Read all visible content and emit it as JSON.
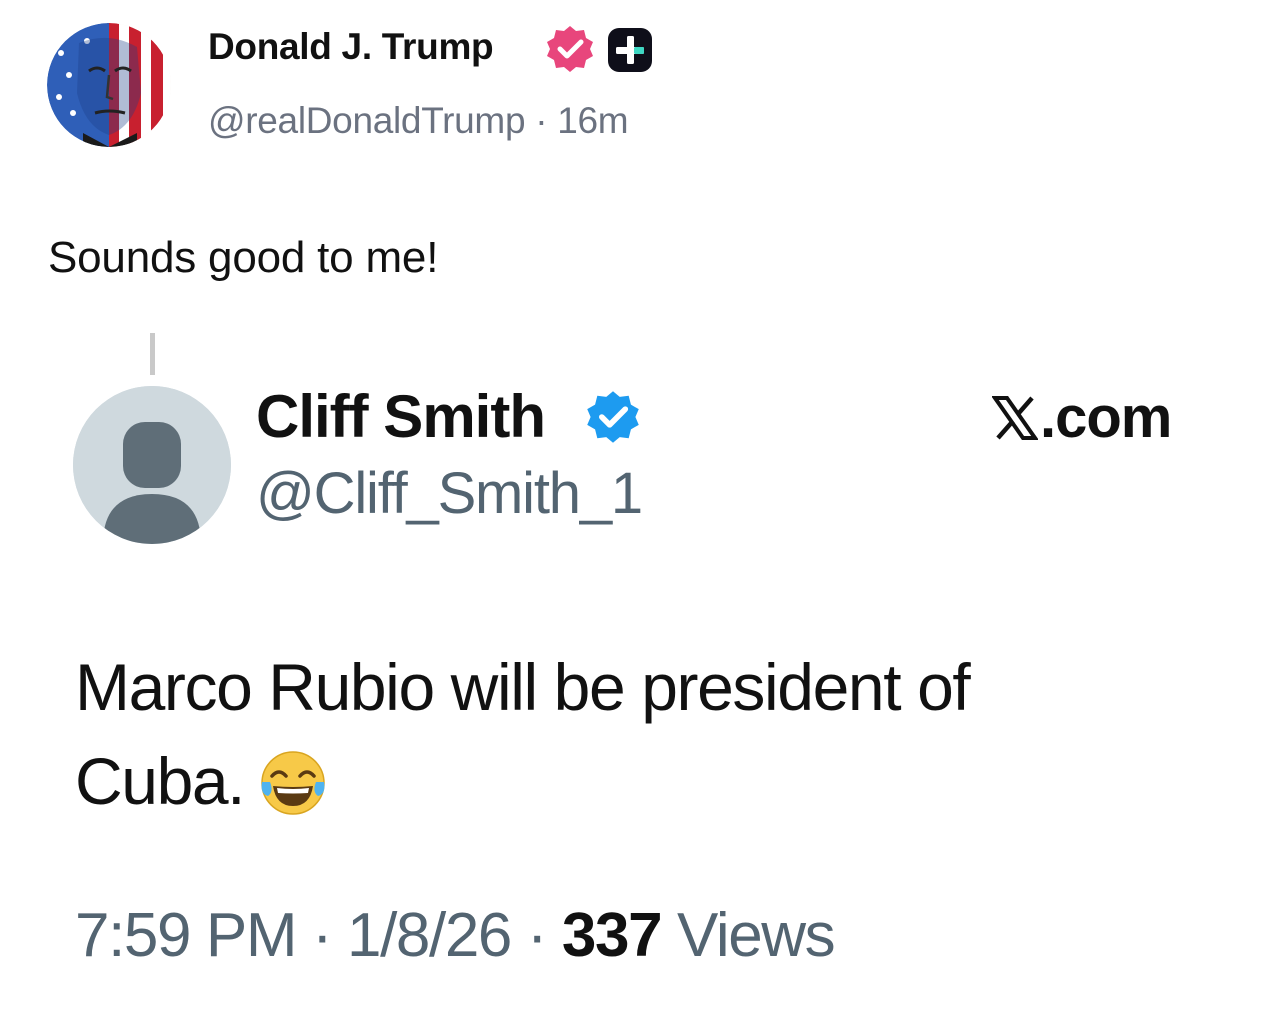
{
  "post": {
    "author_name": "Donald J. Trump",
    "handle": "@realDonaldTrump",
    "separator": "·",
    "time_ago": "16m",
    "text": "Sounds good to me!",
    "icons": {
      "avatar": "flag-portrait-avatar",
      "verified": "verified-badge-icon",
      "plus": "truth-plus-icon"
    },
    "colors": {
      "verified": "#e8467c",
      "plus_badge": "#0f0f1a",
      "plus_accent": "#3ed8c3"
    }
  },
  "quoted": {
    "author_name": "Cliff Smith",
    "handle": "@Cliff_Smith_1",
    "source": "X.com",
    "source_suffix": ".com",
    "body_line1": "Marco Rubio will be president of",
    "body_line2": "Cuba.",
    "emoji": "face-with-tears-of-joy",
    "time": "7:59 PM",
    "date": "1/8/26",
    "separator": "·",
    "views_count": "337",
    "views_label": "Views",
    "colors": {
      "verified": "#1d9bf0",
      "muted": "#536471"
    }
  }
}
